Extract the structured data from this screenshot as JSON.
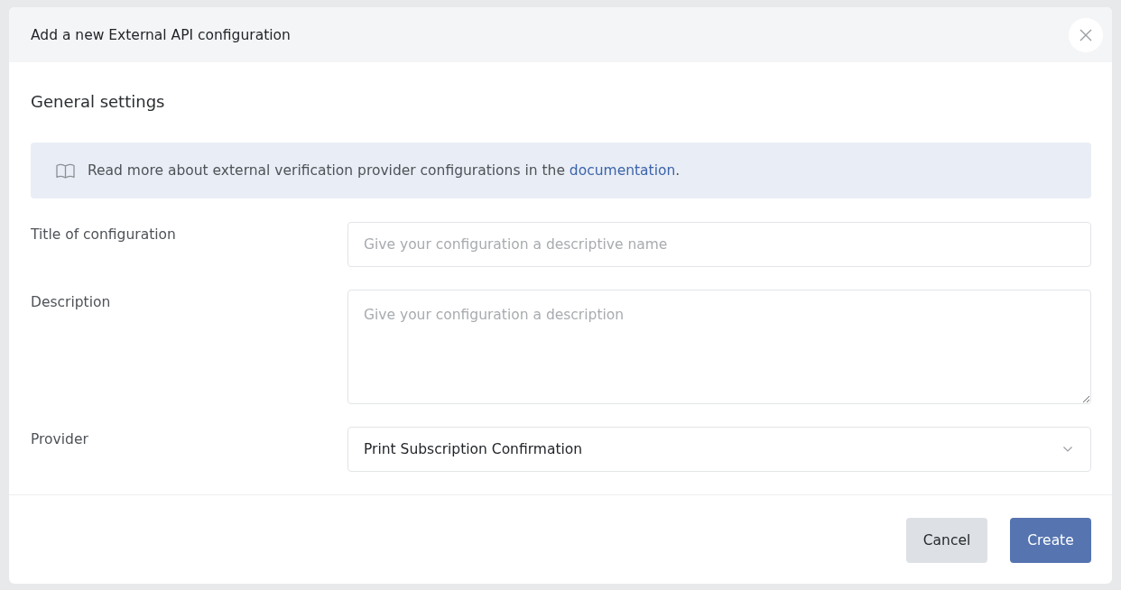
{
  "dialog": {
    "title": "Add a new External API configuration",
    "section_title": "General settings",
    "info": {
      "text": "Read more about external verification provider configurations in the",
      "link": "documentation",
      "after_link": "."
    },
    "fields": [
      {
        "kind": "input",
        "label": "Title of configuration",
        "placeholder": "Give your configuration a descriptive name"
      },
      {
        "kind": "textarea",
        "label": "Description",
        "placeholder": "Give your configuration a description"
      },
      {
        "kind": "select",
        "label": "Provider",
        "value": "Print Subscription Confirmation"
      }
    ],
    "buttons": [
      {
        "kind": "secondary",
        "label": "Cancel"
      },
      {
        "kind": "primary",
        "label": "Create"
      }
    ]
  }
}
